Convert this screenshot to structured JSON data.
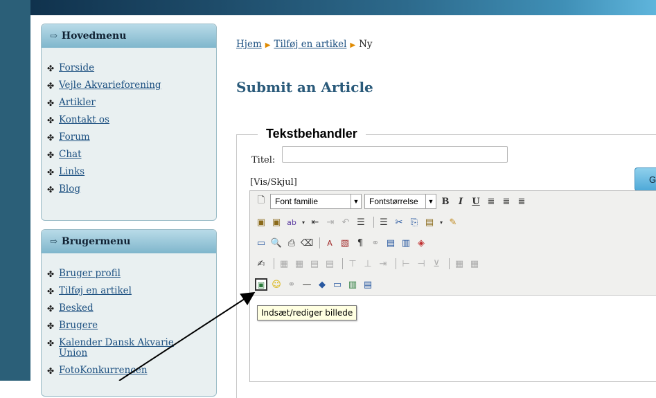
{
  "header": {
    "banner_color_left": "#10324d",
    "banner_color_right": "#5fb5dc"
  },
  "main_menu": {
    "title": "Hovedmenu",
    "items": [
      {
        "label": "Forside"
      },
      {
        "label": "Vejle Akvarieforening"
      },
      {
        "label": "Artikler"
      },
      {
        "label": "Kontakt os"
      },
      {
        "label": "Forum"
      },
      {
        "label": "Chat"
      },
      {
        "label": "Links"
      },
      {
        "label": "Blog"
      }
    ]
  },
  "user_menu": {
    "title": "Brugermenu",
    "items": [
      {
        "label": "Bruger profil"
      },
      {
        "label": "Tilføj en artikel"
      },
      {
        "label": "Besked"
      },
      {
        "label": "Brugere"
      },
      {
        "label": "Kalender Dansk Akvarie Union"
      },
      {
        "label": "FotoKonkurrencen"
      }
    ]
  },
  "breadcrumb": {
    "home": "Hjem",
    "add_article": "Tilføj en artikel",
    "current": "Ny"
  },
  "page": {
    "title": "Submit an Article"
  },
  "form": {
    "legend": "Tekstbehandler",
    "title_label": "Titel:",
    "title_value": "",
    "go_button": "G",
    "vis_skjul": "[Vis/Skjul]"
  },
  "editor": {
    "font_family": "Font familie",
    "font_size": "Fontstørrelse",
    "tooltip": "Indsæt/rediger billede"
  }
}
